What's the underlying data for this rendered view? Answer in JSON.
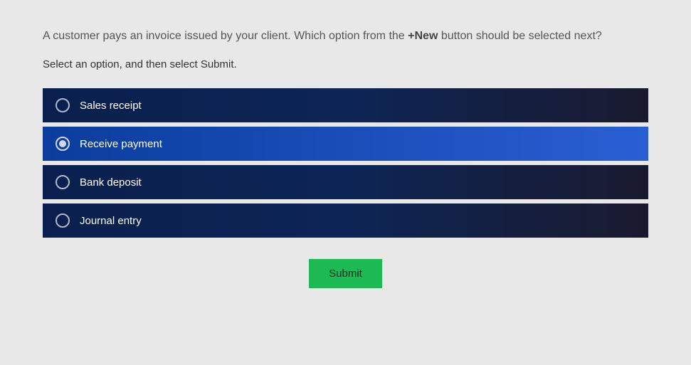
{
  "question": {
    "text_before": "A customer pays an invoice issued by your client. Which option from the ",
    "bold_text": "+New",
    "text_after": " button should be selected next?"
  },
  "instruction": "Select an option, and then select Submit.",
  "options": [
    {
      "label": "Sales receipt",
      "selected": false
    },
    {
      "label": "Receive payment",
      "selected": true
    },
    {
      "label": "Bank deposit",
      "selected": false
    },
    {
      "label": "Journal entry",
      "selected": false
    }
  ],
  "submit_label": "Submit"
}
